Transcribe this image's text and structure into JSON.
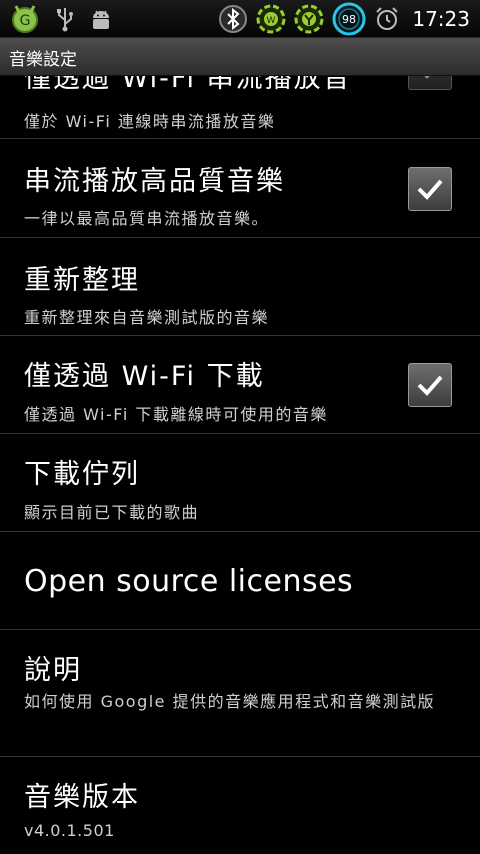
{
  "status_bar": {
    "left_icons": [
      "app-notification-icon",
      "usb-icon",
      "android-debug-icon"
    ],
    "right_icons": [
      "bluetooth-icon",
      "wifi-widget-icon",
      "signal-widget-icon",
      "battery-ring-icon",
      "alarm-clock-icon"
    ],
    "battery_level": "98",
    "clock": "17:23"
  },
  "title_bar": {
    "title": "音樂設定"
  },
  "preferences": [
    {
      "title": "僅透過 Wi-Fi 串流播放音",
      "summary": "僅於 Wi-Fi 連線時串流播放音樂",
      "checked": true
    },
    {
      "title": "串流播放高品質音樂",
      "summary": "一律以最高品質串流播放音樂。",
      "checked": true
    },
    {
      "title": "重新整理",
      "summary": "重新整理來自音樂測試版的音樂"
    },
    {
      "title": "僅透過 Wi-Fi 下載",
      "summary": "僅透過 Wi-Fi 下載離線時可使用的音樂",
      "checked": true
    },
    {
      "title": "下載佇列",
      "summary": "顯示目前已下載的歌曲"
    },
    {
      "title": "Open source licenses"
    },
    {
      "title": "說明",
      "summary": "如何使用 Google 提供的音樂應用程式和音樂測試版"
    },
    {
      "title": "音樂版本",
      "summary": "v4.0.1.501"
    }
  ],
  "colors": {
    "background": "#000000",
    "title_bar": "#3c3c3c",
    "divider": "#333333",
    "checkbox": "#555555"
  }
}
